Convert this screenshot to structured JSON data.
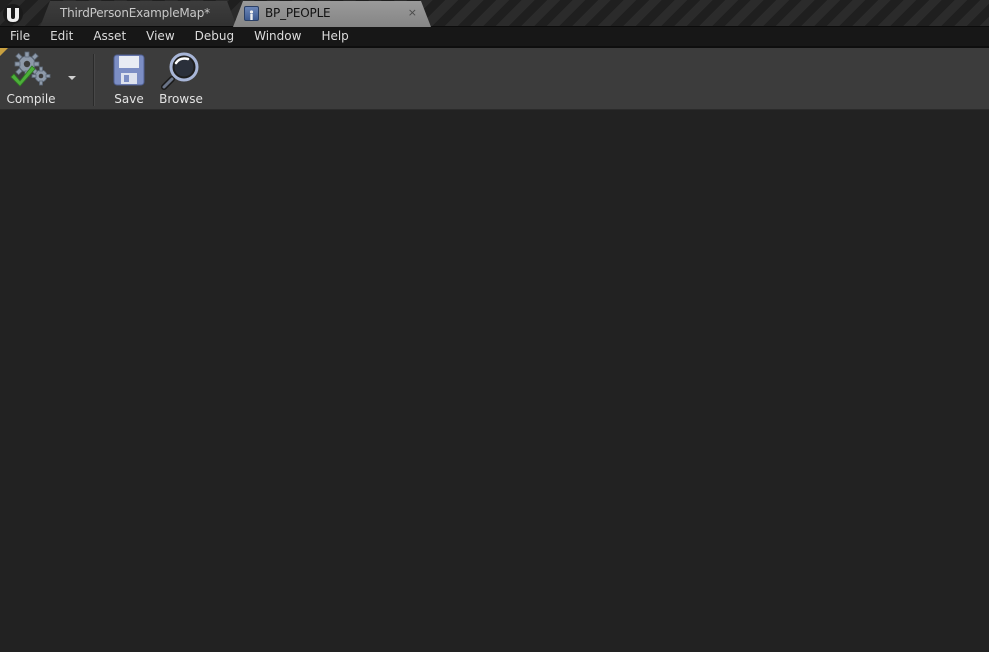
{
  "tabs": [
    {
      "label": "ThirdPersonExampleMap*",
      "active": false,
      "icon": "none"
    },
    {
      "label": "BP_PEOPLE",
      "active": true,
      "icon": "blueprint-icon",
      "close": "×"
    }
  ],
  "menu": {
    "items": [
      "File",
      "Edit",
      "Asset",
      "View",
      "Debug",
      "Window",
      "Help"
    ]
  },
  "toolbar": {
    "compile_label": "Compile",
    "save_label": "Save",
    "browse_label": "Browse"
  },
  "colors": {
    "main_background": "#222222",
    "toolbar_background": "#3c3c3c",
    "menubar_background": "#171717",
    "active_tab": "#8f8f8f",
    "compile_check": "#4caf3a"
  }
}
